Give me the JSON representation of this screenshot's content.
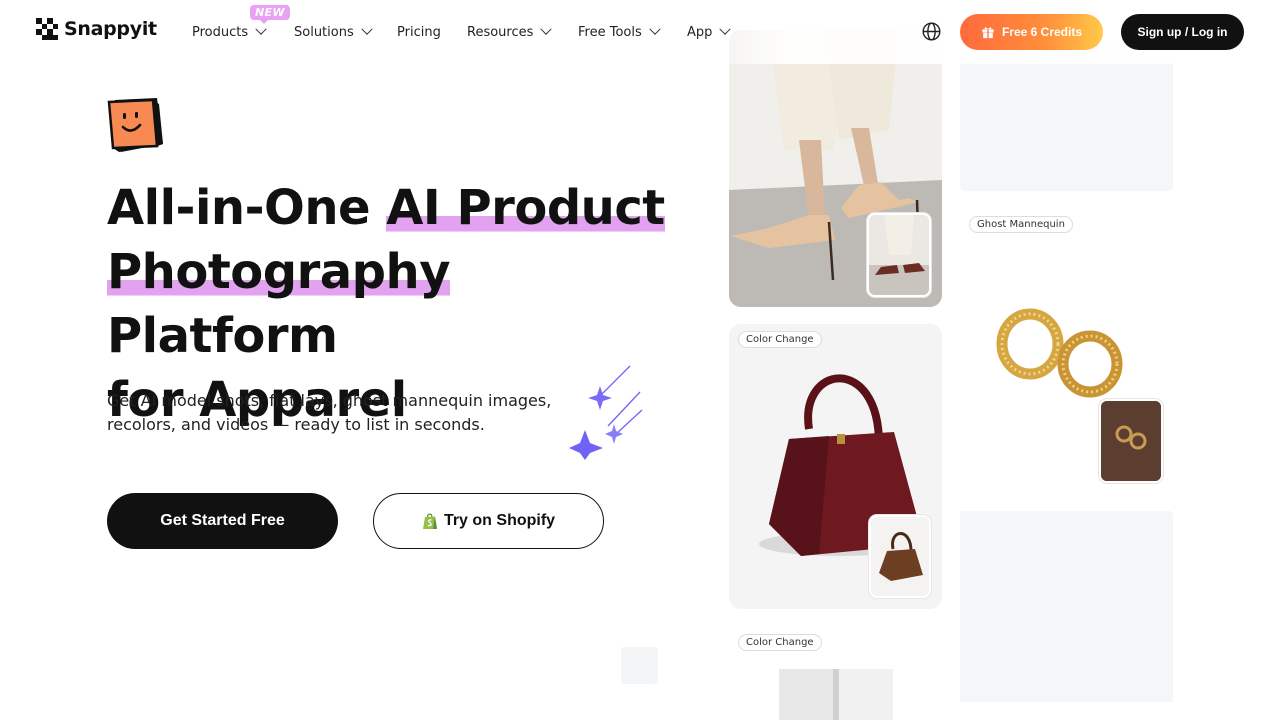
{
  "brand": {
    "name": "Snappyit"
  },
  "nav": {
    "items": [
      {
        "label": "Products",
        "has_dropdown": true,
        "badge": "NEW"
      },
      {
        "label": "Solutions",
        "has_dropdown": true
      },
      {
        "label": "Pricing",
        "has_dropdown": false
      },
      {
        "label": "Resources",
        "has_dropdown": true
      },
      {
        "label": "Free Tools",
        "has_dropdown": true
      },
      {
        "label": "App",
        "has_dropdown": true
      }
    ],
    "language_icon": "globe-icon",
    "credits_button": "Free 6 Credits",
    "credits_icon": "gift-icon",
    "signup_button": "Sign up / Log in"
  },
  "hero": {
    "headline": {
      "part1": "All-in-One ",
      "highlight1": "AI Product",
      "highlight2": "Photography",
      "part2": " Platform",
      "part3": "for Apparel"
    },
    "subtitle": "Get AI model shots, flat lays, ghost mannequin images, recolors, and videos — ready to list in seconds.",
    "primary_cta": "Get Started Free",
    "secondary_cta": "Try on Shopify",
    "secondary_icon": "shopify-bag-icon"
  },
  "gallery": {
    "cards": [
      {
        "tag": ""
      },
      {
        "tag": "Color Change"
      },
      {
        "tag": "Color Change"
      },
      {
        "tag": ""
      },
      {
        "tag": "Ghost Mannequin"
      },
      {
        "tag": ""
      }
    ]
  },
  "colors": {
    "accent_highlight": "#e3a2ef",
    "credits_gradient_start": "#ff6a3d",
    "credits_gradient_end": "#ffc94a",
    "dark": "#111111",
    "stars": "#6f63f5"
  }
}
